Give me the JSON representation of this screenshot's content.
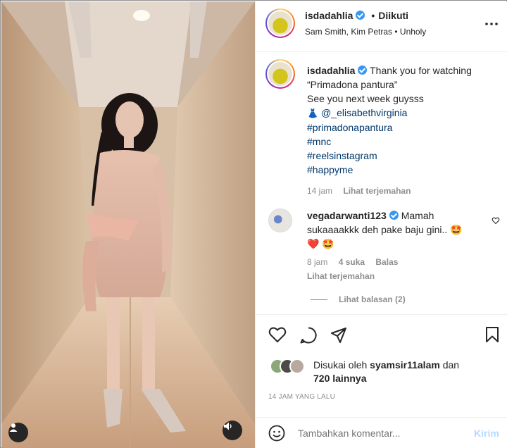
{
  "post": {
    "author": "isdadahlia",
    "follow_separator": "•",
    "follow_status": "Diikuti",
    "audio": "Sam Smith, Kim Petras • Unholy"
  },
  "caption": {
    "username": "isdadahlia",
    "line1": "Thank you for watching",
    "line2": "“Primadona pantura”",
    "line3": "See you next week guysss",
    "emoji_dress": "👗",
    "mention": "@_elisabethvirginia",
    "hashtags": [
      "#primadonapantura",
      "#mnc",
      "#reelsinstagram",
      "#happyme"
    ],
    "time": "14 jam",
    "translate": "Lihat terjemahan"
  },
  "comment": {
    "username": "vegadarwanti123",
    "text_line1": "Mamah",
    "text_line2": "sukaaaakkk deh pake baju gini..",
    "emoji1": "🤩",
    "emoji2": "❤️",
    "emoji3": "🤩",
    "time": "8 jam",
    "likes": "4 suka",
    "reply": "Balas",
    "translate": "Lihat terjemahan",
    "view_replies": "Lihat balasan (2)"
  },
  "likes": {
    "prefix": "Disukai oleh",
    "user": "syamsir11alam",
    "connector": "dan",
    "others": "720 lainnya"
  },
  "timestamp": "14 JAM YANG LALU",
  "add_comment": {
    "placeholder": "Tambahkan komentar...",
    "submit": "Kirim"
  },
  "colors": {
    "verified_blue": "#3897f0",
    "link_blue": "#00376b",
    "submit_disabled": "#b3dbff",
    "text_primary": "#262626",
    "text_secondary": "#8e8e8e"
  }
}
